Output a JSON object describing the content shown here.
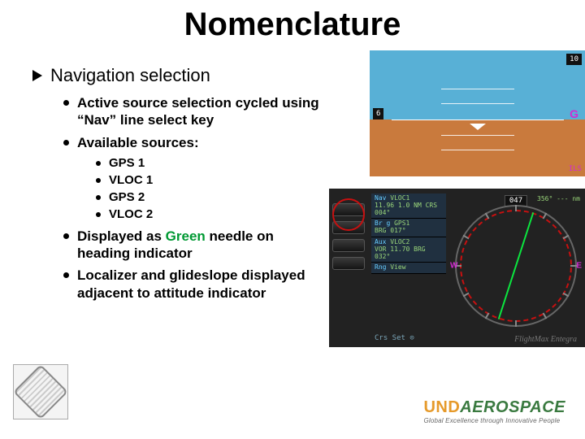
{
  "title": "Nomenclature",
  "h1": "Navigation selection",
  "bullets1": [
    "Active source selection cycled using “Nav” line select key",
    "Available sources:"
  ],
  "bullets2": [
    "GPS 1",
    "VLOC 1",
    "GPS 2",
    "VLOC 2"
  ],
  "bullets1b_pre": "Displayed as ",
  "bullets1b_green": "Green",
  "bullets1b_post": " needle on heading indicator",
  "bullets1c": "Localizer and glideslope displayed adjacent to attitude indicator",
  "pfd": {
    "left_box": "6",
    "right_box": "10",
    "mag_glyph": "G",
    "ils": "ILS"
  },
  "mfd": {
    "labels": [
      {
        "n": "Nav",
        "g": "VLOC1",
        "x": "11.96\n1.0 NM\nCRS 004°"
      },
      {
        "n": "Br g",
        "g": "GPS1",
        "x": "BRG 017°"
      },
      {
        "n": "Aux",
        "g": "VLOC2",
        "x": "VOR\n11.70\nBRG 032°"
      },
      {
        "n": "Rng",
        "g": "View",
        "x": ""
      }
    ],
    "hdg": "047",
    "readout": "356°\n--- nm",
    "lub_l": "W",
    "lub_r": "E",
    "crs": "Crs Set ⊙",
    "branding": "FlightMax Entegra"
  },
  "footer": {
    "und_u": "UND",
    "und_a": "AEROSPACE",
    "tag": "Global Excellence through Innovative People"
  }
}
